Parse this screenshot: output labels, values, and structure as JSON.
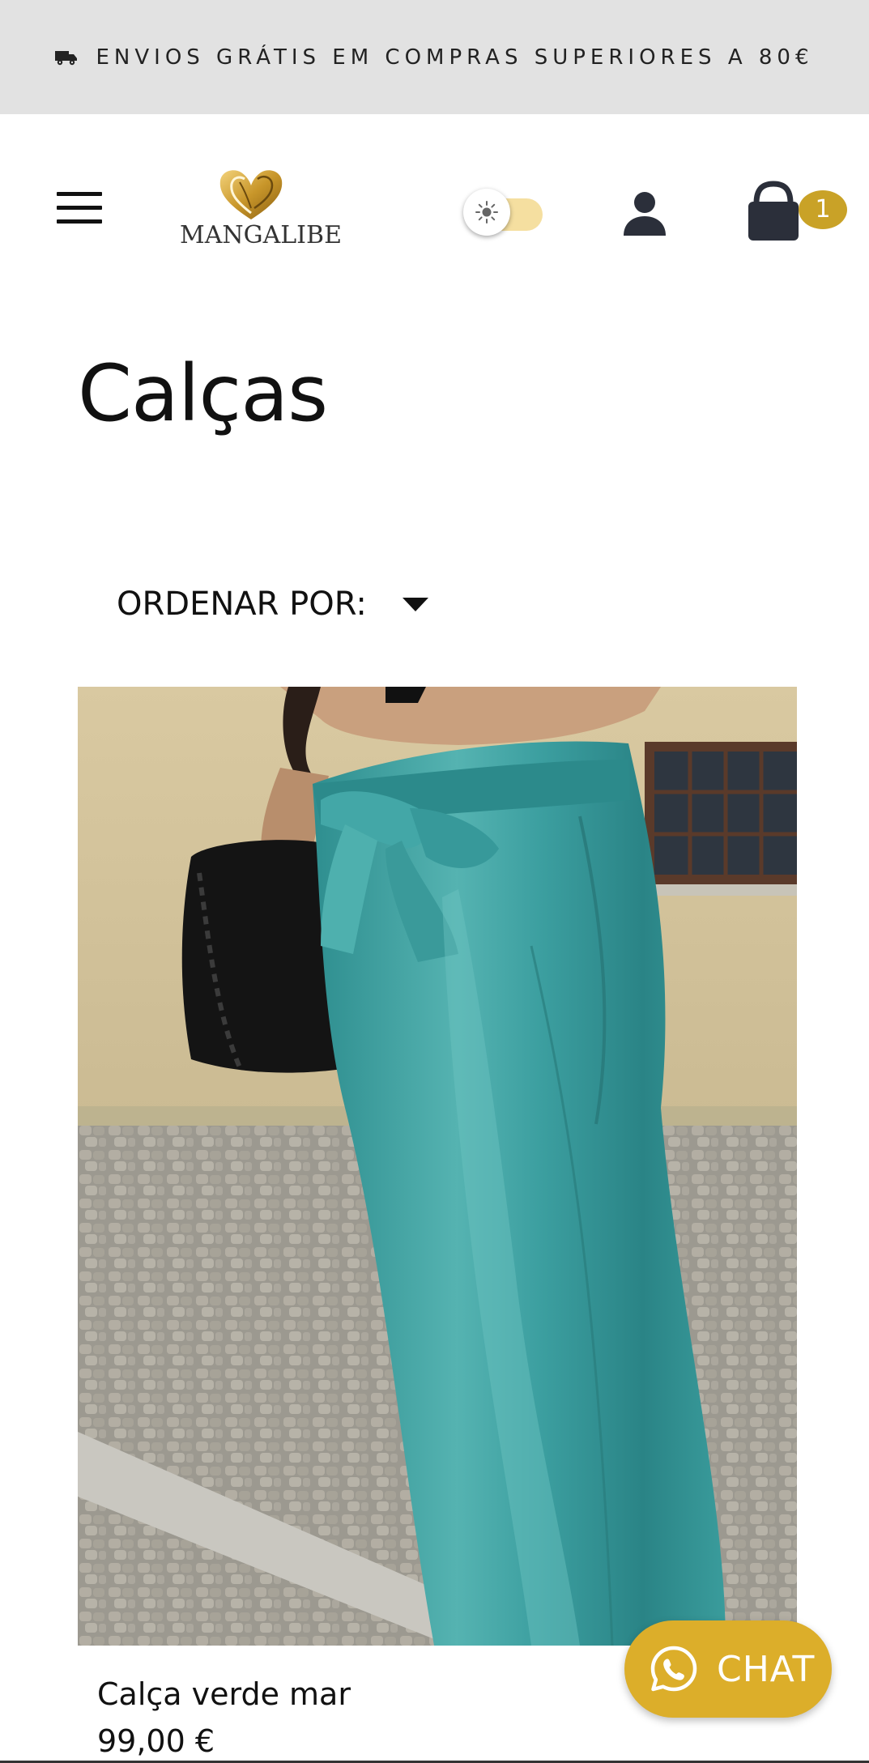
{
  "promo": {
    "icon": "truck-icon",
    "text": "ENVIOS GRÁTIS EM COMPRAS SUPERIORES A 80€"
  },
  "header": {
    "menu_icon": "hamburger-menu-icon",
    "logo_text": "MANGALIBE",
    "theme_toggle": {
      "icon": "sun-icon",
      "state": "light"
    },
    "account_icon": "user-icon",
    "cart": {
      "icon": "shopping-bag-icon",
      "count": "1"
    }
  },
  "page": {
    "title": "Calças"
  },
  "sort": {
    "label": "ORDENAR POR:",
    "icon": "caret-down-icon"
  },
  "products": [
    {
      "name": "Calça verde mar",
      "price": "99,00 €"
    }
  ],
  "chat": {
    "label": "CHAT",
    "icon": "whatsapp-icon"
  },
  "colors": {
    "accent": "#c9a227",
    "chat_button": "#dcae2a",
    "promo_bg": "#e2e2e2",
    "toggle_track": "#f5dfa0"
  }
}
